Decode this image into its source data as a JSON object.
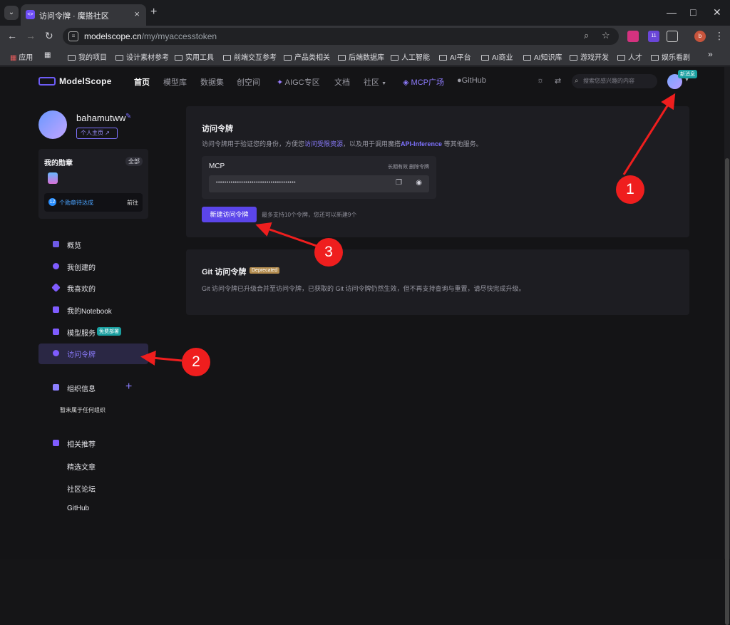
{
  "browser": {
    "tab_title": "访问令牌 · 魔搭社区",
    "tab_favicon": "<>",
    "new_tab": "+",
    "url_host": "modelscope.cn",
    "url_path": "/my/myaccesstoken",
    "bookmarks": [
      "应用",
      "我的项目",
      "设计素材参考",
      "实用工具",
      "前端交互参考",
      "产品类相关",
      "后端数据库",
      "人工智能",
      "AI平台",
      "AI商业",
      "AI知识库",
      "游戏开发",
      "人才",
      "娱乐看剧"
    ],
    "ext_badge": "11",
    "profile_letter": "b",
    "more": "»"
  },
  "nav": {
    "logo": "ModelScope",
    "items": [
      "首页",
      "模型库",
      "数据集",
      "创空间",
      "AIGC专区",
      "文档",
      "社区",
      "MCP广场",
      "GitHub"
    ],
    "search_placeholder": "搜索您感兴趣的内容",
    "new_badge": "新消息"
  },
  "profile": {
    "username": "bahamutww",
    "homepage": "个人主页"
  },
  "medals": {
    "title": "我的勋章",
    "all": "全部",
    "pending_count": "12",
    "pending_text": "个勋章待达成",
    "go": "前往"
  },
  "menu": {
    "items": [
      "概览",
      "我创建的",
      "我喜欢的",
      "我的Notebook",
      "模型服务",
      "访问令牌"
    ],
    "free_tag": "免费部署",
    "org_title": "组织信息",
    "org_empty": "暂未属于任何组织",
    "rec_title": "相关推荐",
    "rec_links": [
      "精选文章",
      "社区论坛",
      "GitHub"
    ]
  },
  "tokens": {
    "title": "访问令牌",
    "desc_prefix": "访问令牌用于验证您的身份，方便您",
    "desc_link": "访问受限资源",
    "desc_middle": "，以及用于调用魔搭",
    "desc_api": "API-Inference",
    "desc_suffix": " 等其他服务。",
    "token_name": "MCP",
    "token_validity": "长期有效",
    "token_delete": "删除令牌",
    "token_mask": "••••••••••••••••••••••••••••••••••••••",
    "new_button": "新建访问令牌",
    "limit_text": "最多支持10个令牌，您还可以新建9个"
  },
  "git": {
    "title": "Git 访问令牌",
    "deprecated": "Deprecated",
    "desc": "Git 访问令牌已升级合并至访问令牌，已获取的 Git 访问令牌仍然生效，但不再支持查询与重置，请尽快完成升级。"
  },
  "callouts": [
    "1",
    "2",
    "3"
  ],
  "colors": {
    "accent": "#5b45ea",
    "link": "#8b7cff",
    "callout": "#ef1e1e"
  }
}
